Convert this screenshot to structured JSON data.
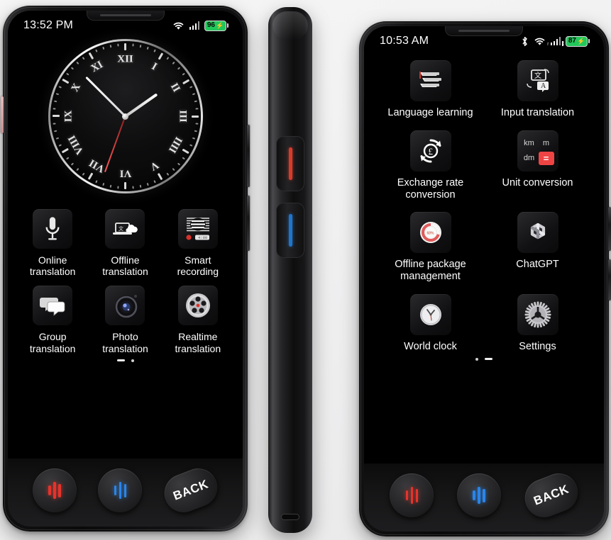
{
  "scene": {
    "description": "Three views of a handheld AI translator device: front view page 1, side profile, front view page 2"
  },
  "phone_left": {
    "status_bar": {
      "time": "13:52 PM",
      "icons": [
        "wifi-icon",
        "signal-icon",
        "battery-icon"
      ],
      "battery_percent": "96",
      "battery_charging": "⚡",
      "battery_color": "#22c75b"
    },
    "clock_widget": {
      "name": "analog-clock-widget",
      "numerals": [
        "I",
        "II",
        "III",
        "IIII",
        "V",
        "VI",
        "VII",
        "VIII",
        "IX",
        "X",
        "XI",
        "XII"
      ],
      "hour_angle": 55,
      "minute_angle": 315,
      "second_angle": 200
    },
    "apps": [
      {
        "label": "Online\ntranslation",
        "icon": "microphone-icon"
      },
      {
        "label": "Offline\ntranslation",
        "icon": "laptop-cloud-icon"
      },
      {
        "label": "Smart\nrecording",
        "icon": "voice-recorder-icon"
      },
      {
        "label": "Group\ntranslation",
        "icon": "speech-bubbles-icon"
      },
      {
        "label": "Photo\ntranslation",
        "icon": "camera-lens-icon"
      },
      {
        "label": "Realtime\ntranslation",
        "icon": "mic-array-icon"
      }
    ],
    "page_indicator": {
      "pages": 2,
      "active": 1
    },
    "buttons": [
      {
        "name": "red-voice-button",
        "icon": "waveform-icon",
        "color": "#e5342c",
        "label": ""
      },
      {
        "name": "blue-voice-button",
        "icon": "waveform-icon",
        "color": "#2b85e8",
        "label": ""
      },
      {
        "name": "back-button",
        "icon": "",
        "color": "#ffffff",
        "label": "BACK"
      }
    ]
  },
  "phone_side": {
    "buttons": [
      {
        "name": "side-button-red",
        "color": "#d93b2b"
      },
      {
        "name": "side-button-blue",
        "color": "#1f74cc"
      }
    ],
    "port": "usb-c-port"
  },
  "phone_right": {
    "status_bar": {
      "time": "10:53 AM",
      "icons": [
        "bluetooth-icon",
        "wifi-icon",
        "signal-icon",
        "battery-icon"
      ],
      "battery_percent": "87",
      "battery_charging": "⚡",
      "battery_color": "#22c75b",
      "wifi_badge": "r",
      "signal_badge": "x"
    },
    "apps": [
      {
        "label": "Language learning",
        "icon": "books-stack-icon"
      },
      {
        "label": "Input translation",
        "icon": "translate-icon"
      },
      {
        "label": "Exchange rate\nconversion",
        "icon": "currency-exchange-icon"
      },
      {
        "label": "Unit conversion",
        "icon": "unit-grid-icon"
      },
      {
        "label": "Offline package\nmanagement",
        "icon": "package-ring-icon"
      },
      {
        "label": "ChatGPT",
        "icon": "chatgpt-icon"
      },
      {
        "label": "World clock",
        "icon": "world-clock-icon"
      },
      {
        "label": "Settings",
        "icon": "gear-icon"
      }
    ],
    "unit_icon": {
      "cells": [
        "km",
        "m",
        "dm",
        "="
      ],
      "accent": "#ef4444"
    },
    "page_indicator": {
      "pages": 2,
      "active": 2
    },
    "buttons": [
      {
        "name": "red-voice-button",
        "icon": "waveform-icon",
        "color": "#e5342c",
        "label": ""
      },
      {
        "name": "blue-voice-button",
        "icon": "waveform-icon",
        "color": "#2b85e8",
        "label": ""
      },
      {
        "name": "back-button",
        "icon": "",
        "color": "#ffffff",
        "label": "BACK"
      }
    ]
  }
}
